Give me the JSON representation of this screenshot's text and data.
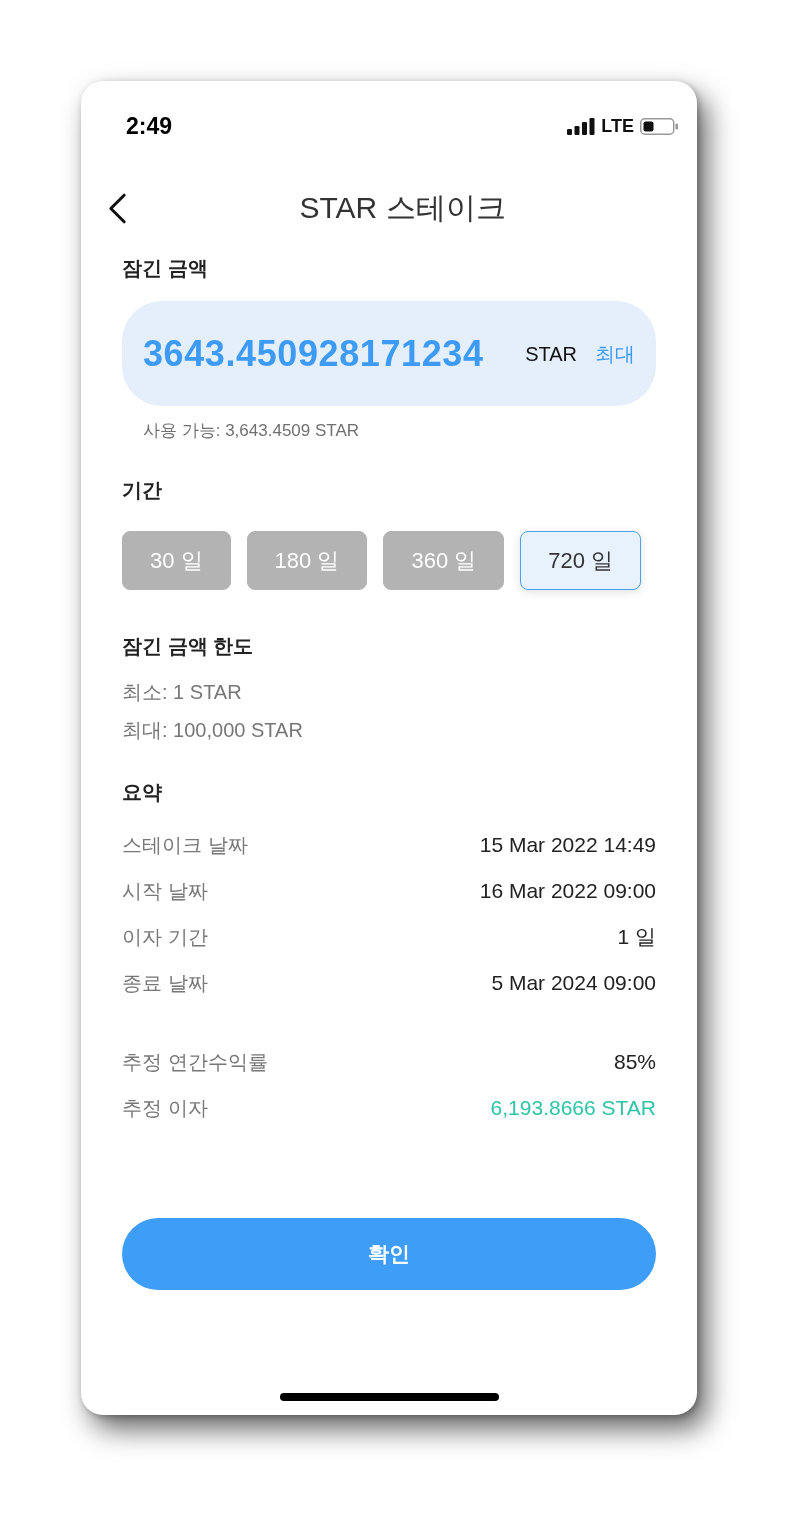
{
  "status_bar": {
    "time": "2:49",
    "network": "LTE"
  },
  "header": {
    "title": "STAR 스테이크"
  },
  "amount": {
    "label": "잠긴 금액",
    "value": "3643.450928171234",
    "unit": "STAR",
    "max_button": "최대",
    "available": "사용 가능: 3,643.4509 STAR"
  },
  "period": {
    "label": "기간",
    "options": [
      {
        "label": "30 일",
        "selected": false
      },
      {
        "label": "180 일",
        "selected": false
      },
      {
        "label": "360 일",
        "selected": false
      },
      {
        "label": "720 일",
        "selected": true
      }
    ]
  },
  "limits": {
    "label": "잠긴 금액 한도",
    "lines": [
      "최소: 1 STAR",
      "최대: 100,000 STAR"
    ]
  },
  "summary": {
    "label": "요약",
    "rows": [
      {
        "label": "스테이크 날짜",
        "value": "15 Mar 2022 14:49"
      },
      {
        "label": "시작 날짜",
        "value": "16 Mar 2022 09:00"
      },
      {
        "label": "이자 기간",
        "value": "1 일"
      },
      {
        "label": "종료 날짜",
        "value": "5 Mar 2024 09:00"
      }
    ],
    "estimates": [
      {
        "label": "추정 연간수익률",
        "value": "85%",
        "color": "#222222"
      },
      {
        "label": "추정 이자",
        "value": "6,193.8666 STAR",
        "color": "#2ec4a8"
      }
    ]
  },
  "confirm_button": "확인"
}
